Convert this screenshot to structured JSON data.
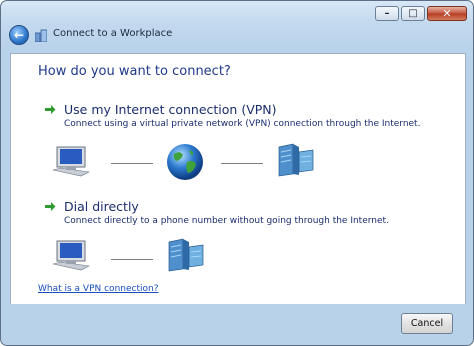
{
  "window": {
    "title": "Connect to a Workplace",
    "controls": {
      "minimize": "–",
      "maximize": "□",
      "close": "✕"
    }
  },
  "page": {
    "heading": "How do you want to connect?",
    "options": [
      {
        "title": "Use my Internet connection (VPN)",
        "description": "Connect using a virtual private network (VPN) connection through the Internet."
      },
      {
        "title": "Dial directly",
        "description": "Connect directly to a phone number without going through the Internet."
      }
    ],
    "help_link": "What is a VPN connection?"
  },
  "footer": {
    "cancel_label": "Cancel"
  },
  "icons": [
    "back-arrow-icon",
    "network-app-icon",
    "green-arrow-icon",
    "computer-icon",
    "globe-icon",
    "server-icon"
  ]
}
